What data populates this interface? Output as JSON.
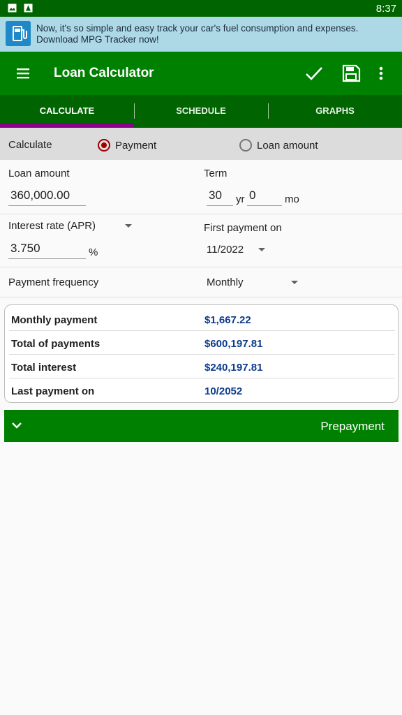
{
  "status_bar": {
    "time": "8:37"
  },
  "ad": {
    "text_line1": "Now, it's so simple and easy track your car's fuel consumption and expenses.",
    "text_line2": "Download MPG Tracker now!"
  },
  "app_bar": {
    "title": "Loan Calculator",
    "actions": [
      "check-icon",
      "save-icon",
      "overflow-menu-icon"
    ]
  },
  "tabs": [
    {
      "label": "CALCULATE",
      "active": true
    },
    {
      "label": "SCHEDULE",
      "active": false
    },
    {
      "label": "GRAPHS",
      "active": false
    }
  ],
  "calculate": {
    "label": "Calculate",
    "options": [
      {
        "label": "Payment",
        "selected": true
      },
      {
        "label": "Loan amount",
        "selected": false
      }
    ]
  },
  "form": {
    "loan_amount_label": "Loan amount",
    "loan_amount_value": "360,000.00",
    "term_label": "Term",
    "term_years": "30",
    "term_years_unit": "yr",
    "term_months": "0",
    "term_months_unit": "mo",
    "interest_label": "Interest rate (APR)",
    "interest_value": "3.750",
    "interest_unit": "%",
    "first_payment_label": "First payment on",
    "first_payment_value": "11/2022",
    "frequency_label": "Payment frequency",
    "frequency_value": "Monthly"
  },
  "results": [
    {
      "label": "Monthly payment",
      "value": "$1,667.22"
    },
    {
      "label": "Total of payments",
      "value": "$600,197.81"
    },
    {
      "label": "Total interest",
      "value": "$240,197.81"
    },
    {
      "label": "Last payment on",
      "value": "10/2052"
    }
  ],
  "prepayment": {
    "label": "Prepayment"
  },
  "colors": {
    "app_bar": "#008000",
    "tab_bar": "#006400",
    "tab_indicator": "#8b008b",
    "result_value": "#0d3b8c",
    "radio_selected": "#a00000"
  }
}
